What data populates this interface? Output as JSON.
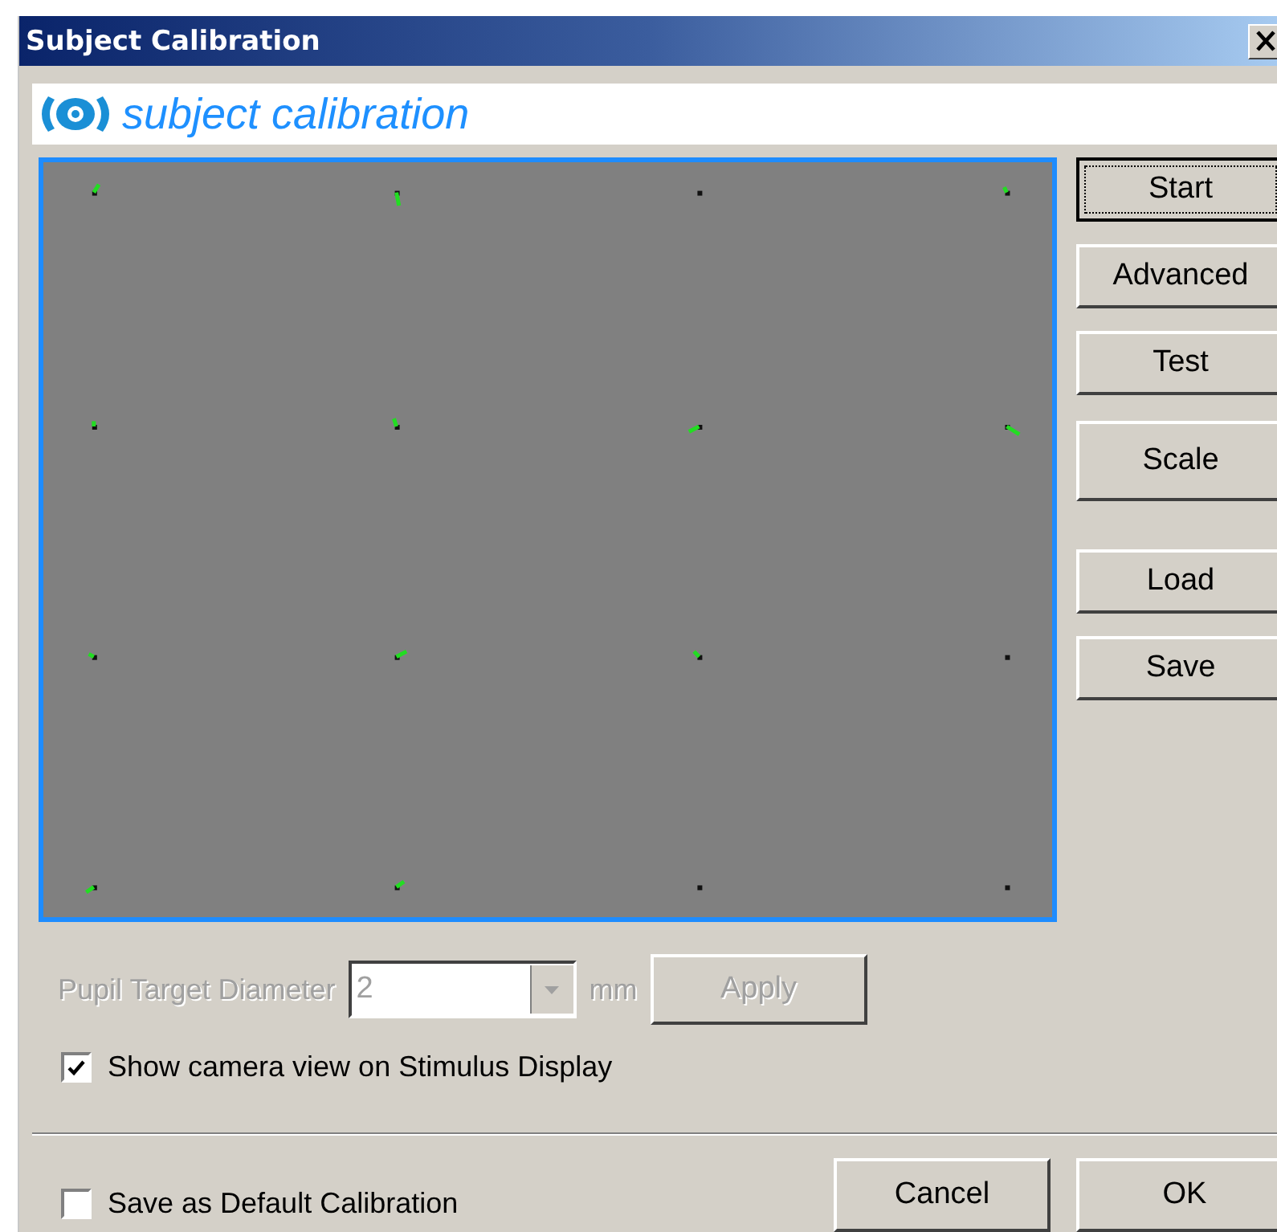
{
  "window": {
    "title": "Subject Calibration"
  },
  "header": {
    "title": "subject calibration"
  },
  "side_buttons": [
    {
      "label": "Start",
      "focused": true
    },
    {
      "label": "Advanced",
      "focused": false
    },
    {
      "label": "Test",
      "focused": false
    },
    {
      "label": "Scale",
      "focused": false
    },
    {
      "label": "Load",
      "focused": false
    },
    {
      "label": "Save",
      "focused": false
    }
  ],
  "pupil_target": {
    "label": "Pupil Target Diameter",
    "value": "2",
    "unit": "mm",
    "disabled": true,
    "apply_button": "Apply"
  },
  "show_camera_view": {
    "label": "Show camera view on Stimulus Display",
    "checked": true
  },
  "save_default": {
    "label": "Save as Default Calibration",
    "checked": false
  },
  "footer_buttons": [
    {
      "label": "Cancel"
    },
    {
      "label": "OK"
    }
  ]
}
